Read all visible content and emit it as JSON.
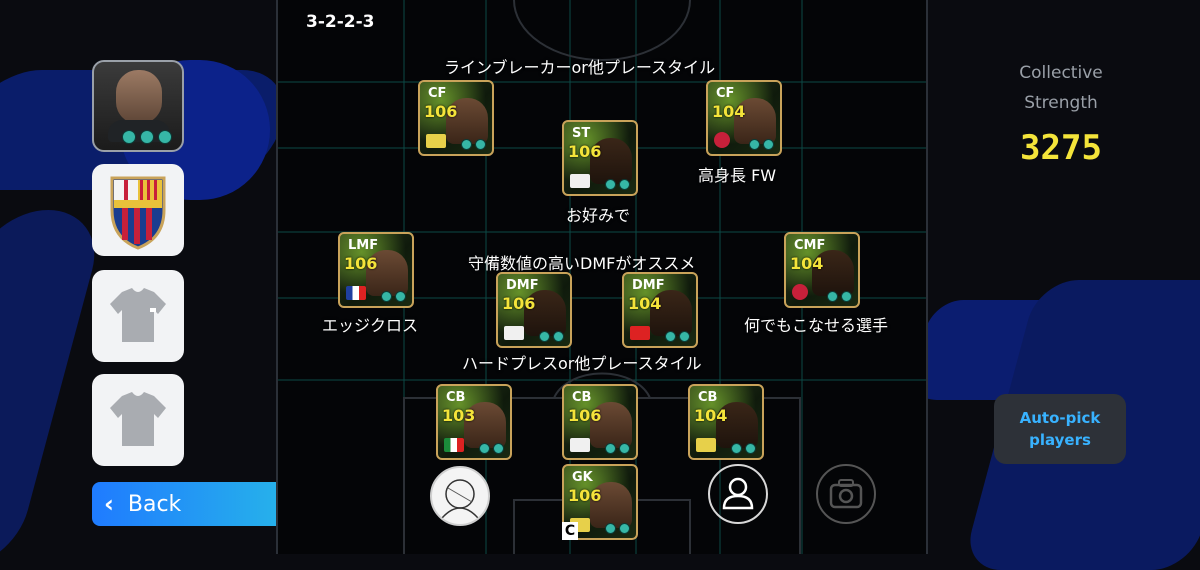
{
  "formation": "3-2-2-3",
  "collective_strength": {
    "label_line1": "Collective",
    "label_line2": "Strength",
    "value": "3275"
  },
  "buttons": {
    "back": "Back",
    "autopick_line1": "Auto-pick",
    "autopick_line2": "players"
  },
  "captain_mark": "C",
  "annotations": {
    "top": "ラインブレーカーor他プレースタイル",
    "st": "お好みで",
    "rcf": "高身長 FW",
    "mid_top": "守備数値の高いDMFがオススメ",
    "lmf": "エッジクロス",
    "cmf": "何でもこなせる選手",
    "mid_bottom": "ハードプレスor他プレースタイル"
  },
  "players": [
    {
      "id": "lcf",
      "pos": "CF",
      "ovr": "106"
    },
    {
      "id": "st",
      "pos": "ST",
      "ovr": "106"
    },
    {
      "id": "rcf",
      "pos": "CF",
      "ovr": "104"
    },
    {
      "id": "lmf",
      "pos": "LMF",
      "ovr": "106"
    },
    {
      "id": "cmf",
      "pos": "CMF",
      "ovr": "104"
    },
    {
      "id": "dmf1",
      "pos": "DMF",
      "ovr": "106"
    },
    {
      "id": "dmf2",
      "pos": "DMF",
      "ovr": "104"
    },
    {
      "id": "lcb",
      "pos": "CB",
      "ovr": "103"
    },
    {
      "id": "ccb",
      "pos": "CB",
      "ovr": "106"
    },
    {
      "id": "rcb",
      "pos": "CB",
      "ovr": "104"
    },
    {
      "id": "gk",
      "pos": "GK",
      "ovr": "106"
    }
  ],
  "colors": {
    "accent_blue": "#1f7bff",
    "rating_yellow": "#f4e43a",
    "skill_teal": "#36b6a6",
    "autopick_text": "#38b2ff"
  }
}
